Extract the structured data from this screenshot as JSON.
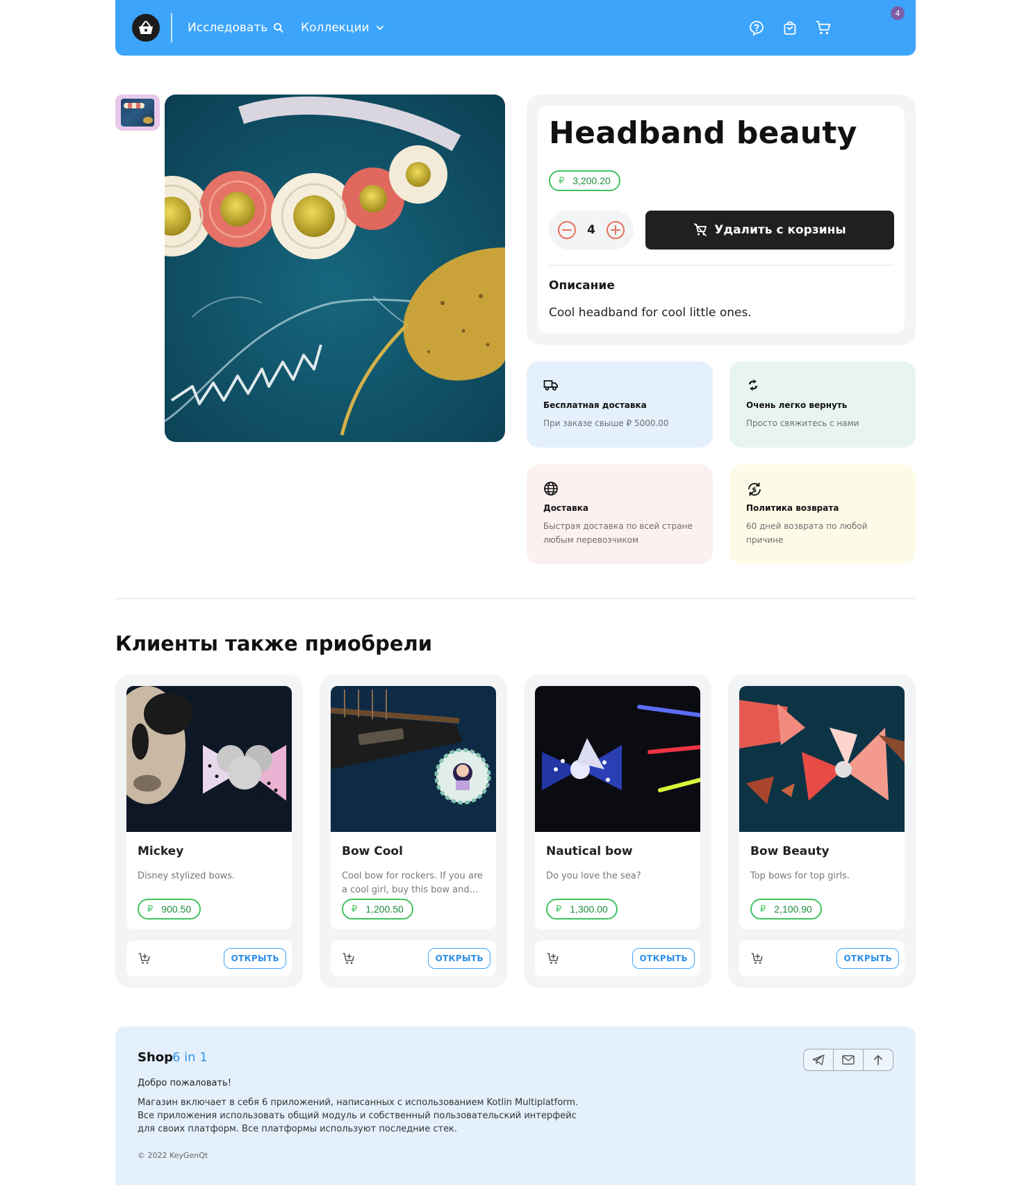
{
  "header": {
    "explore_label": "Исследовать",
    "collections_label": "Коллекции",
    "cart_count": "4"
  },
  "product": {
    "title": "Headband beauty",
    "currency": "₽",
    "price": "3,200.20",
    "quantity": "4",
    "remove_label": "Удалить с корзины",
    "description_heading": "Описание",
    "description": "Cool headband for cool little ones."
  },
  "info_cards": [
    {
      "icon": "truck-icon",
      "title": "Бесплатная доставка",
      "subtitle": "При заказе свыше ₽ 5000.00",
      "bg": "#e4f0fc"
    },
    {
      "icon": "recycle-icon",
      "title": "Очень легко вернуть",
      "subtitle": "Просто свяжитесь с нами",
      "bg": "#e8f5ef"
    },
    {
      "icon": "globe-icon",
      "title": "Доставка",
      "subtitle": "Быстрая доставка по всей стране любым перевозчиком",
      "bg": "#fdf0f0"
    },
    {
      "icon": "refund-icon",
      "title": "Политика возврата",
      "subtitle": "60 дней возврата по любой причине",
      "bg": "#fdfbe8"
    }
  ],
  "related": {
    "title": "Клиенты также приобрели",
    "open_label": "ОТКРЫТЬ",
    "items": [
      {
        "name": "Mickey",
        "description": "Disney stylized bows.",
        "price": "900.50"
      },
      {
        "name": "Bow Cool",
        "description": "Cool bow for rockers. If you are a cool girl, buy this bow and…",
        "price": "1,200.50"
      },
      {
        "name": "Nautical bow",
        "description": "Do you love the sea?",
        "price": "1,300.00"
      },
      {
        "name": "Bow Beauty",
        "description": "Top bows for top girls.",
        "price": "2,100.90"
      }
    ]
  },
  "footer": {
    "brand": "Shop",
    "brand_sub": "6 in 1",
    "welcome": "Добро пожаловать!",
    "text": "Магазин включает в себя 6 приложений, написанных с использованием Kotlin Multiplatform. Все приложения использовать общий модуль и собственный пользовательский интерфейс для своих платформ. Все платформы используют последние стек.",
    "copyright": "© 2022 KeyGenQt"
  },
  "colors": {
    "brand_blue": "#3ca4fb",
    "price_green": "#3fc35f",
    "button_dark": "#202020",
    "badge_purple": "#7b5ea6"
  }
}
